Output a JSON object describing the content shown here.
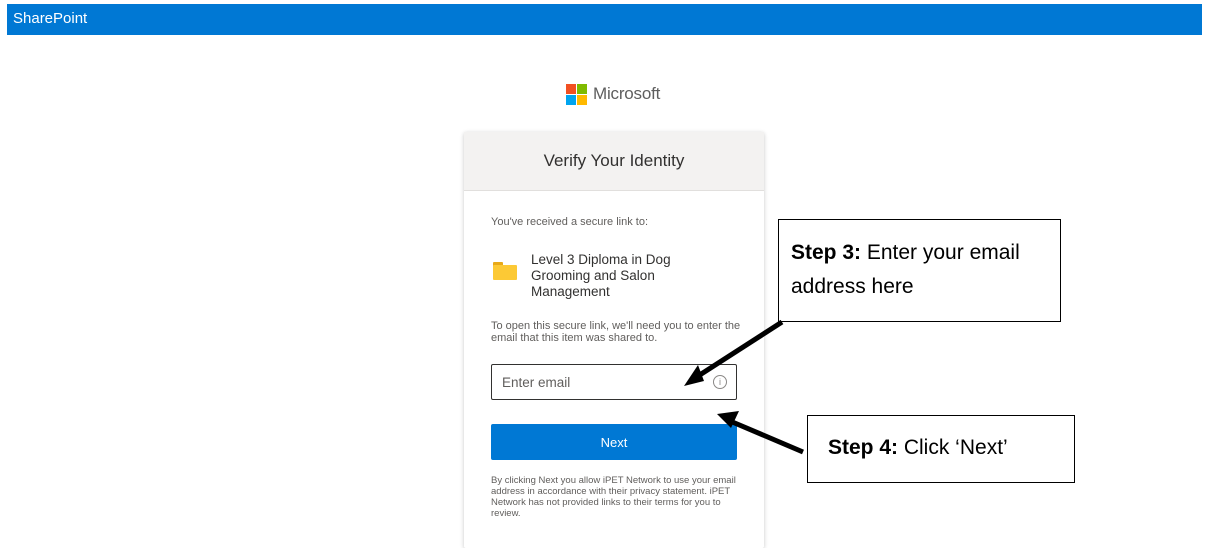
{
  "topbar": {
    "title": "SharePoint"
  },
  "logo": {
    "text": "Microsoft",
    "colors": [
      "#f25022",
      "#7fba00",
      "#00a4ef",
      "#ffb900"
    ]
  },
  "card": {
    "heading": "Verify Your Identity",
    "received_text": "You've received a secure link to:",
    "folder_icon": "folder-icon",
    "folder_name": "Level 3 Diploma in Dog Grooming and Salon Management",
    "open_text": "To open this secure link, we'll need you to enter the email that this item was shared to.",
    "email_placeholder": "Enter email",
    "email_value": "",
    "info_icon": "info-icon",
    "next_label": "Next",
    "disclaimer": "By clicking Next you allow iPET Network to use your email address in accordance with their privacy statement. iPET Network has not provided links to their terms for you to review."
  },
  "annotations": {
    "step3": {
      "label": "Step 3:",
      "text": " Enter your email address here"
    },
    "step4": {
      "label": "Step 4:",
      "text": " Click ‘Next’"
    }
  },
  "colors": {
    "accent": "#0078d4",
    "header_bg": "#f3f2f1"
  }
}
